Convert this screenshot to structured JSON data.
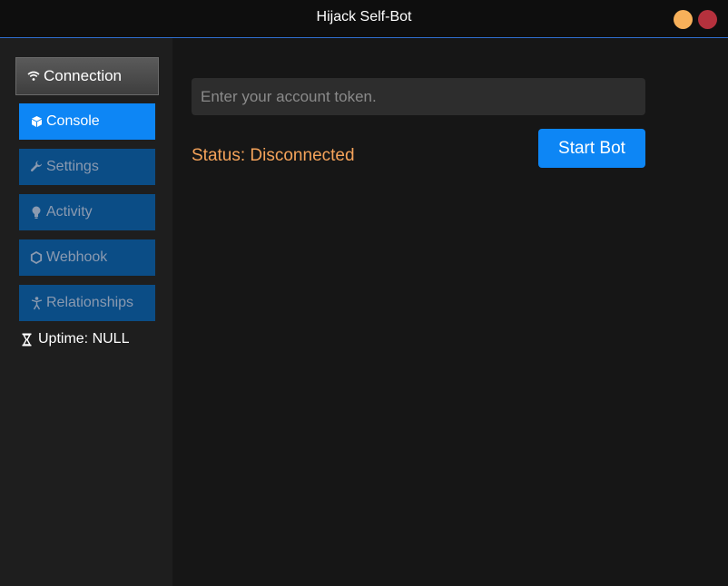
{
  "window": {
    "title": "Hijack Self-Bot",
    "controls": {
      "minimize_color": "#f7b05a",
      "close_color": "#b5313d"
    }
  },
  "sidebar": {
    "items": [
      {
        "id": "connection",
        "label": "Connection",
        "icon": "wifi-icon",
        "state": "selected"
      },
      {
        "id": "console",
        "label": "Console",
        "icon": "cube-icon",
        "state": "active"
      },
      {
        "id": "settings",
        "label": "Settings",
        "icon": "wrench-icon",
        "state": "inactive"
      },
      {
        "id": "activity",
        "label": "Activity",
        "icon": "lightbulb-icon",
        "state": "inactive"
      },
      {
        "id": "webhook",
        "label": "Webhook",
        "icon": "hexagon-icon",
        "state": "inactive"
      },
      {
        "id": "relationships",
        "label": "Relationships",
        "icon": "person-icon",
        "state": "inactive"
      }
    ],
    "uptime": {
      "icon": "hourglass-icon",
      "label": "Uptime: NULL"
    }
  },
  "main": {
    "token_input": {
      "placeholder": "Enter your account token.",
      "value": ""
    },
    "status": {
      "text": "Status: Disconnected",
      "color": "#f5a35a"
    },
    "start_button": {
      "label": "Start Bot"
    }
  },
  "colors": {
    "accent": "#0d86f5",
    "inactive_nav": "#0b4d86",
    "background": "#161616",
    "sidebar": "#1e1e1e"
  }
}
